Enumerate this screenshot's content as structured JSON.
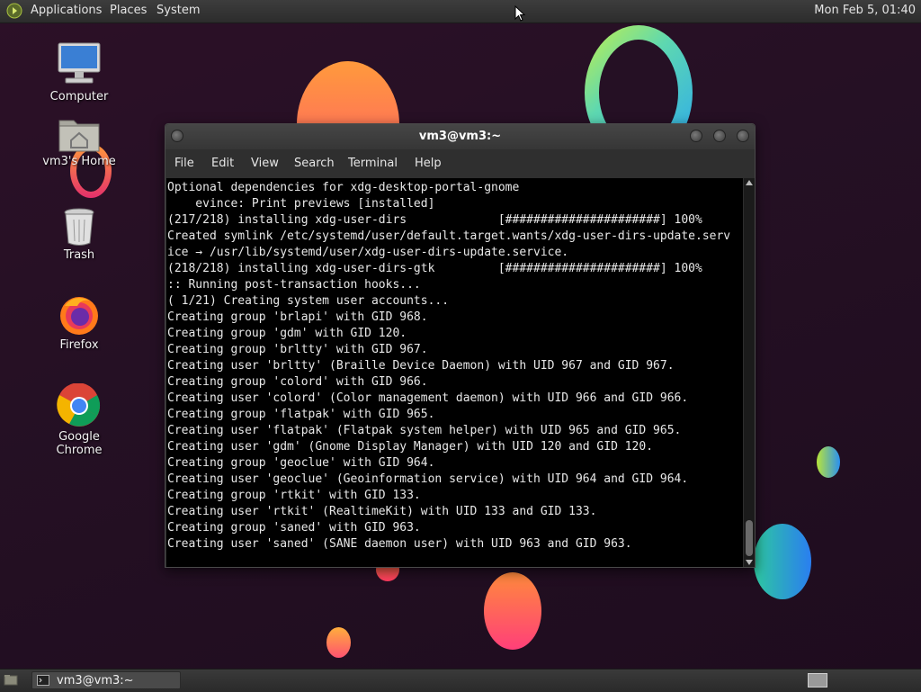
{
  "top_panel": {
    "menus": [
      "Applications",
      "Places",
      "System"
    ],
    "clock": "Mon Feb  5, 01:40"
  },
  "desktop_icons": [
    {
      "label": "Computer",
      "icon": "computer-icon"
    },
    {
      "label": "vm3's Home",
      "icon": "home-folder-icon"
    },
    {
      "label": "Trash",
      "icon": "trash-icon"
    },
    {
      "label": "Firefox",
      "icon": "firefox-icon"
    },
    {
      "label": "Google Chrome",
      "icon": "chrome-icon"
    }
  ],
  "terminal": {
    "title": "vm3@vm3:~",
    "menu": [
      "File",
      "Edit",
      "View",
      "Search",
      "Terminal",
      "Help"
    ],
    "lines": [
      "Optional dependencies for xdg-desktop-portal-gnome",
      "    evince: Print previews [installed]",
      "(217/218) installing xdg-user-dirs             [######################] 100%",
      "Created symlink /etc/systemd/user/default.target.wants/xdg-user-dirs-update.serv",
      "ice → /usr/lib/systemd/user/xdg-user-dirs-update.service.",
      "(218/218) installing xdg-user-dirs-gtk         [######################] 100%",
      ":: Running post-transaction hooks...",
      "( 1/21) Creating system user accounts...",
      "Creating group 'brlapi' with GID 968.",
      "Creating group 'gdm' with GID 120.",
      "Creating group 'brltty' with GID 967.",
      "Creating user 'brltty' (Braille Device Daemon) with UID 967 and GID 967.",
      "Creating group 'colord' with GID 966.",
      "Creating user 'colord' (Color management daemon) with UID 966 and GID 966.",
      "Creating group 'flatpak' with GID 965.",
      "Creating user 'flatpak' (Flatpak system helper) with UID 965 and GID 965.",
      "Creating user 'gdm' (Gnome Display Manager) with UID 120 and GID 120.",
      "Creating group 'geoclue' with GID 964.",
      "Creating user 'geoclue' (Geoinformation service) with UID 964 and GID 964.",
      "Creating group 'rtkit' with GID 133.",
      "Creating user 'rtkit' (RealtimeKit) with UID 133 and GID 133.",
      "Creating group 'saned' with GID 963.",
      "Creating user 'saned' (SANE daemon user) with UID 963 and GID 963."
    ]
  },
  "taskbar": {
    "task_label": "vm3@vm3:~"
  },
  "colors": {
    "desktop_bg": "#251024",
    "terminal_bg": "#000000",
    "terminal_fg": "#e8e8e8",
    "panel_bg": "#333333"
  }
}
